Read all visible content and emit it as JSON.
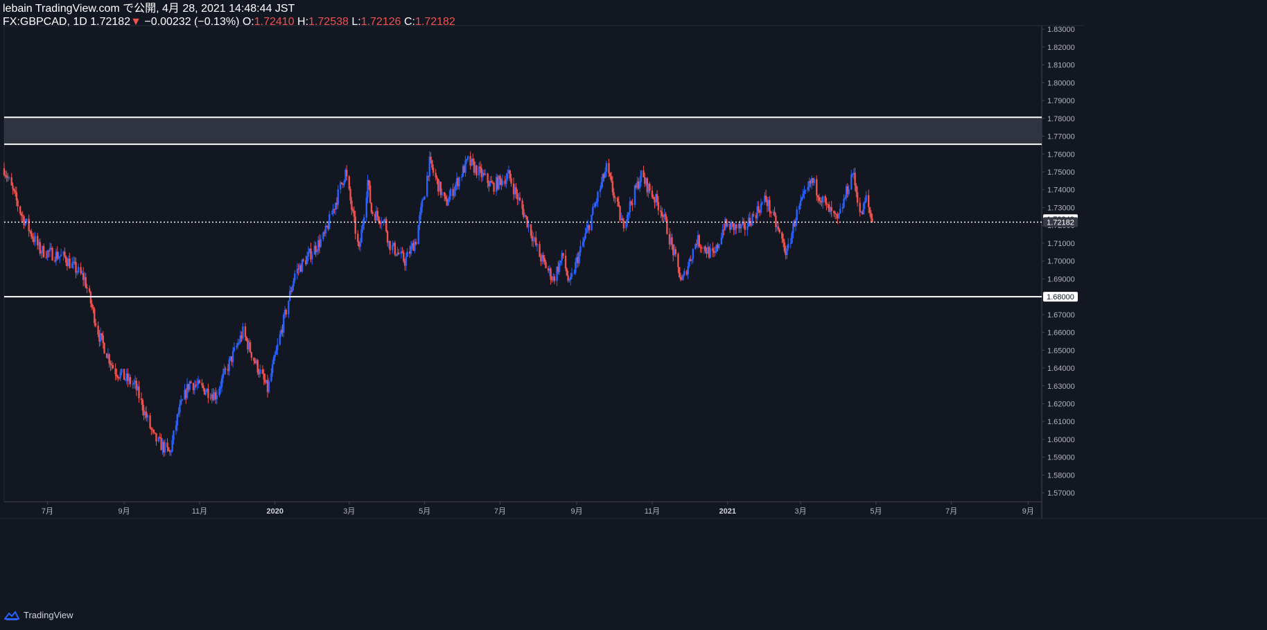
{
  "header": {
    "line1": "lebain TradingView.com で公開, 4月 28, 2021 14:48:44 JST",
    "symbol": "FX:GBPCAD, 1D",
    "last": "1.72182",
    "change_arrow": "▼",
    "change": "−0.00232 (−0.13%)",
    "o_label": "O:",
    "o_value": "1.72410",
    "h_label": "H:",
    "h_value": "1.72538",
    "l_label": "L:",
    "l_value": "1.72126",
    "c_label": "C:",
    "c_value": "1.72182"
  },
  "footer": {
    "brand": "TradingView",
    "logo_icon": "tradingview-logo-icon"
  },
  "colors": {
    "background": "#131722",
    "up": "#2962ff",
    "down": "#ef5350",
    "zone": "#363a45",
    "line": "#ffffff",
    "axis_text": "#b2b5be"
  },
  "chart_data": {
    "type": "candlestick",
    "symbol": "FX:GBPCAD",
    "interval": "1D",
    "ylim": [
      1.565,
      1.832
    ],
    "y_ticks": [
      "1.83000",
      "1.82000",
      "1.81000",
      "1.80000",
      "1.79000",
      "1.78000",
      "1.77000",
      "1.76000",
      "1.75000",
      "1.74000",
      "1.73000",
      "1.72000",
      "1.71000",
      "1.70000",
      "1.69000",
      "1.68000",
      "1.67000",
      "1.66000",
      "1.65000",
      "1.64000",
      "1.63000",
      "1.62000",
      "1.61000",
      "1.60000",
      "1.59000",
      "1.58000",
      "1.57000"
    ],
    "x_ticks": [
      "7月",
      "9月",
      "11月",
      "2020",
      "3月",
      "5月",
      "7月",
      "9月",
      "11月",
      "2021",
      "3月",
      "5月",
      "7月",
      "9月"
    ],
    "x_tick_dates": [
      "2019-07-01",
      "2019-09-01",
      "2019-11-01",
      "2020-01-01",
      "2020-03-01",
      "2020-05-01",
      "2020-07-01",
      "2020-09-01",
      "2020-11-01",
      "2021-01-01",
      "2021-03-01",
      "2021-05-01",
      "2021-07-01",
      "2021-09-01"
    ],
    "x_range": [
      "2019-05-27",
      "2021-09-12"
    ],
    "price_labels": [
      {
        "value": "1.72349",
        "price": 1.72349,
        "style": "light"
      },
      {
        "value": "1.72182",
        "price": 1.72182,
        "style": "dark"
      },
      {
        "value": "1.68000",
        "price": 1.68,
        "style": "light"
      }
    ],
    "horizontal_lines": [
      1.7806,
      1.7655,
      1.68
    ],
    "zone": [
      1.7655,
      1.7806
    ],
    "last_price_line": 1.72182,
    "path_dates": [
      "2019-05-27",
      "2019-06-10",
      "2019-06-25",
      "2019-07-15",
      "2019-07-31",
      "2019-08-12",
      "2019-08-24",
      "2019-09-10",
      "2019-09-25",
      "2019-10-08",
      "2019-10-15",
      "2019-10-24",
      "2019-11-14",
      "2019-12-06",
      "2019-12-15",
      "2019-12-26",
      "2020-01-17",
      "2020-02-10",
      "2020-02-27",
      "2020-03-09",
      "2020-03-16",
      "2020-03-19",
      "2020-03-30",
      "2020-04-02",
      "2020-04-15",
      "2020-04-24",
      "2020-05-05",
      "2020-05-18",
      "2020-06-05",
      "2020-06-25",
      "2020-07-08",
      "2020-07-23",
      "2020-08-02",
      "2020-08-13",
      "2020-08-21",
      "2020-08-26",
      "2020-09-01",
      "2020-09-07",
      "2020-09-25",
      "2020-10-08",
      "2020-10-23",
      "2020-11-09",
      "2020-11-25",
      "2020-12-07",
      "2020-12-21",
      "2020-12-29",
      "2021-01-14",
      "2021-02-01",
      "2021-02-18",
      "2021-02-25",
      "2021-03-10",
      "2021-03-22",
      "2021-03-31",
      "2021-04-12",
      "2021-04-19",
      "2021-04-23",
      "2021-04-28"
    ],
    "path_closes": [
      1.752,
      1.726,
      1.706,
      1.702,
      1.69,
      1.658,
      1.639,
      1.63,
      1.601,
      1.592,
      1.615,
      1.632,
      1.625,
      1.66,
      1.645,
      1.628,
      1.693,
      1.714,
      1.75,
      1.705,
      1.745,
      1.728,
      1.722,
      1.71,
      1.7,
      1.712,
      1.755,
      1.732,
      1.756,
      1.742,
      1.748,
      1.722,
      1.703,
      1.69,
      1.703,
      1.686,
      1.7,
      1.712,
      1.752,
      1.72,
      1.748,
      1.728,
      1.688,
      1.712,
      1.702,
      1.72,
      1.718,
      1.735,
      1.704,
      1.725,
      1.745,
      1.73,
      1.722,
      1.75,
      1.725,
      1.735,
      1.72182
    ],
    "series": [
      {
        "name": "GBPCAD",
        "last": 1.72182
      }
    ]
  }
}
